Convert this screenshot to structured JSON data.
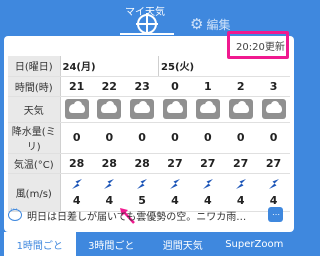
{
  "header": {
    "title": "マイ天気",
    "icon": "crosshair-icon",
    "edit_label": "編集",
    "edit_icon": "gear-icon"
  },
  "update": {
    "text": "20:20更新"
  },
  "table": {
    "dates": [
      "24(月)",
      "25(火)"
    ],
    "row_labels": {
      "date": "日(曜日)",
      "time": "時間(時)",
      "weather": "天気",
      "rain": "降水量(ミリ)",
      "temp": "気温(°C)",
      "wind": "風(m/s)"
    },
    "hours": [
      "21",
      "22",
      "23",
      "0",
      "1",
      "2",
      "3"
    ],
    "weather": [
      "cloudy",
      "cloudy",
      "cloudy",
      "cloudy",
      "cloudy",
      "cloudy",
      "cloudy"
    ],
    "rain": [
      "0",
      "0",
      "0",
      "0",
      "0",
      "0",
      "0"
    ],
    "temp": [
      "28",
      "28",
      "28",
      "27",
      "27",
      "27",
      "27"
    ],
    "wind_speed": [
      "4",
      "4",
      "5",
      "4",
      "4",
      "4",
      "4"
    ],
    "wind_direction": [
      "southwest",
      "southwest",
      "southwest",
      "southwest",
      "southwest",
      "southwest",
      "southwest"
    ]
  },
  "comment": {
    "text": "明日は日差しが届いても雲優勢の空。ニワカ雨…",
    "more_label": "⋯"
  },
  "tabs": [
    "1時間ごと",
    "3時間ごと",
    "週間天気",
    "SuperZoom"
  ],
  "colors": {
    "brand": "#3f88de",
    "highlight": "#f0198f",
    "wind_arrow": "#1d56b8"
  }
}
